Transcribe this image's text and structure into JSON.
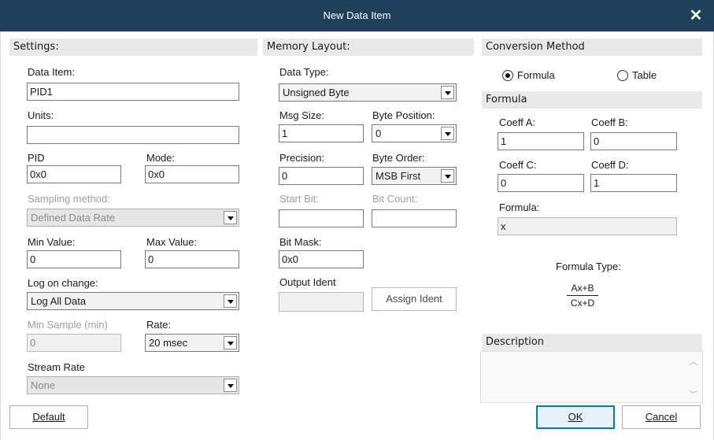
{
  "window": {
    "title": "New Data Item",
    "close_glyph": "✕"
  },
  "settings": {
    "header": "Settings:",
    "data_item_label": "Data Item:",
    "data_item_value": "PID1",
    "units_label": "Units:",
    "units_value": "",
    "pid_label": "PID",
    "pid_value": "0x0",
    "mode_label": "Mode:",
    "mode_value": "0x0",
    "sampling_label": "Sampling method:",
    "sampling_value": "Defined Data Rate",
    "min_label": "Min Value:",
    "min_value": "0",
    "max_label": "Max Value:",
    "max_value": "0",
    "log_label": "Log on change:",
    "log_value": "Log All Data",
    "min_sample_label": "Min Sample (min)",
    "min_sample_value": "0",
    "rate_label": "Rate:",
    "rate_value": "20 msec",
    "stream_label": "Stream Rate",
    "stream_value": "None"
  },
  "memory": {
    "header": "Memory Layout:",
    "data_type_label": "Data Type:",
    "data_type_value": "Unsigned Byte",
    "msg_size_label": "Msg Size:",
    "msg_size_value": "1",
    "byte_pos_label": "Byte Position:",
    "byte_pos_value": "0",
    "precision_label": "Precision:",
    "precision_value": "0",
    "byte_order_label": "Byte Order:",
    "byte_order_value": "MSB First",
    "start_bit_label": "Start Bit:",
    "start_bit_value": "",
    "bit_count_label": "Bit Count:",
    "bit_count_value": "",
    "bit_mask_label": "Bit Mask:",
    "bit_mask_value": "0x0",
    "output_ident_label": "Output Ident",
    "output_ident_value": "",
    "assign_ident_label": "Assign Ident"
  },
  "conversion": {
    "header": "Conversion Method",
    "radio_formula": "Formula",
    "radio_table": "Table",
    "selected": "Formula",
    "formula_header": "Formula",
    "coeff_a_label": "Coeff A:",
    "coeff_a_value": "1",
    "coeff_b_label": "Coeff B:",
    "coeff_b_value": "0",
    "coeff_c_label": "Coeff C:",
    "coeff_c_value": "0",
    "coeff_d_label": "Coeff D:",
    "coeff_d_value": "1",
    "formula_label": "Formula:",
    "formula_value": "x",
    "formula_type_label": "Formula Type:",
    "formula_numerator": "Ax+B",
    "formula_denominator": "Cx+D",
    "description_header": "Description",
    "description_value": ""
  },
  "buttons": {
    "default_label": "Default",
    "ok_label": "OK",
    "cancel_label": "Cancel"
  },
  "colors": {
    "titlebar": "#1f3f5b",
    "accent": "#0078d7",
    "section_bg": "#e9e9e9"
  }
}
